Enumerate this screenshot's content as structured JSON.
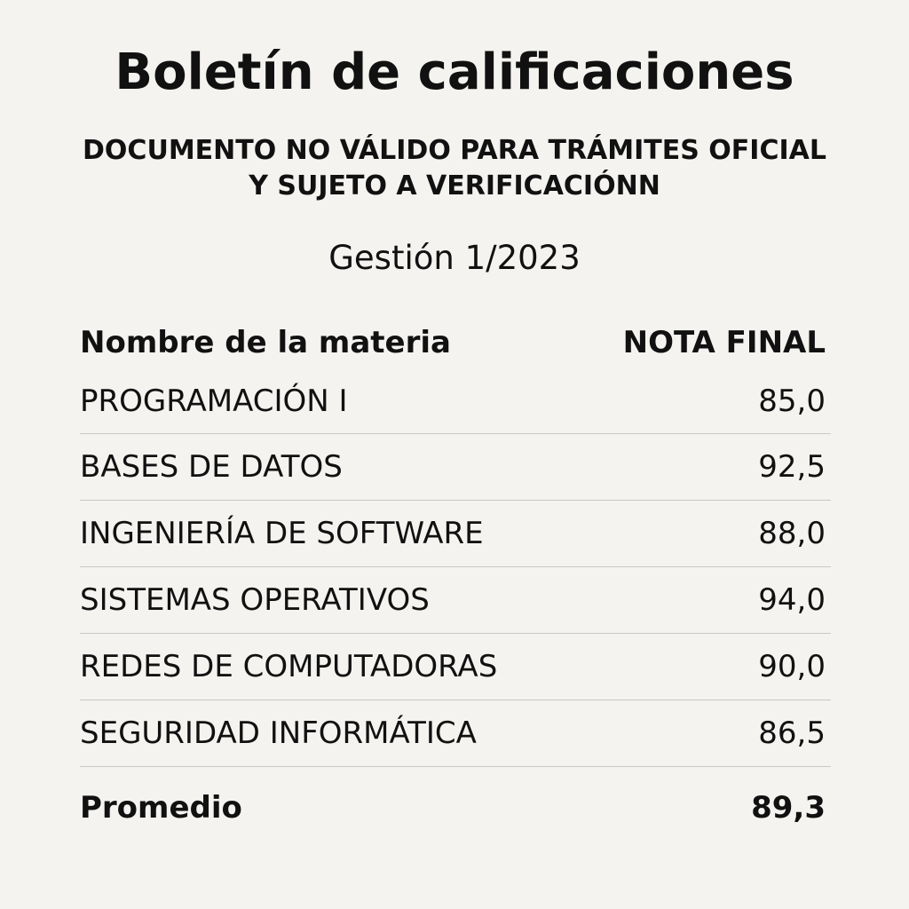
{
  "document": {
    "title": "Boletín de calificaciones",
    "notice_line1": "DOCUMENTO NO VÁLIDO PARA TRÁMITES OFICIAL",
    "notice_line2": "Y SUJETO A VERIFICACIÓNN",
    "period": "Gestión 1/2023"
  },
  "table": {
    "headers": {
      "subject": "Nombre de la materia",
      "grade": "NOTA FINAL"
    },
    "rows": [
      {
        "subject": "PROGRAMACIÓN I",
        "grade": "85,0"
      },
      {
        "subject": "BASES DE DATOS",
        "grade": "92,5"
      },
      {
        "subject": "INGENIERÍA DE SOFTWARE",
        "grade": "88,0"
      },
      {
        "subject": "SISTEMAS OPERATIVOS",
        "grade": "94,0"
      },
      {
        "subject": "REDES DE COMPUTADORAS",
        "grade": "90,0"
      },
      {
        "subject": "SEGURIDAD INFORMÁTICA",
        "grade": "86,5"
      }
    ],
    "total": {
      "label": "Promedio",
      "value": "89,3"
    }
  }
}
